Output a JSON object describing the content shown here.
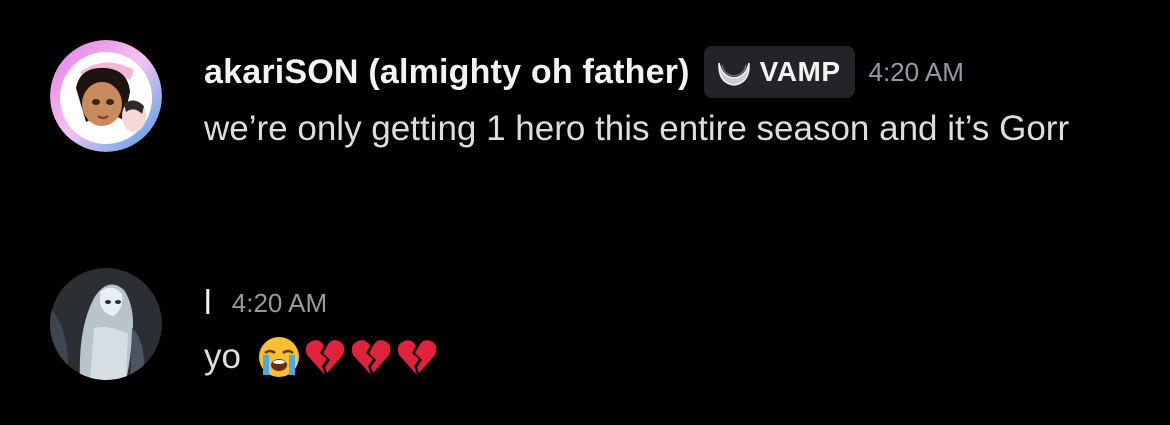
{
  "messages": [
    {
      "author": "akariSON (almighty oh father)",
      "tag": {
        "label": "VAMP",
        "icon": "crescent-moon-badge-icon"
      },
      "timestamp": "4:20 AM",
      "text": "we’re only getting 1 hero this entire season and it’s Gorr"
    },
    {
      "author": "l",
      "timestamp": "4:20 AM",
      "text": "yo",
      "emojis": [
        "loudly-crying-face",
        "broken-heart",
        "broken-heart",
        "broken-heart"
      ]
    }
  ],
  "colors": {
    "background": "#000000",
    "username": "#f2f3f5",
    "body_text": "#dbdee1",
    "timestamp": "#949ba4",
    "tag_background": "#232428",
    "broken_heart": "#e0223a",
    "crying_face": "#f7c034"
  }
}
